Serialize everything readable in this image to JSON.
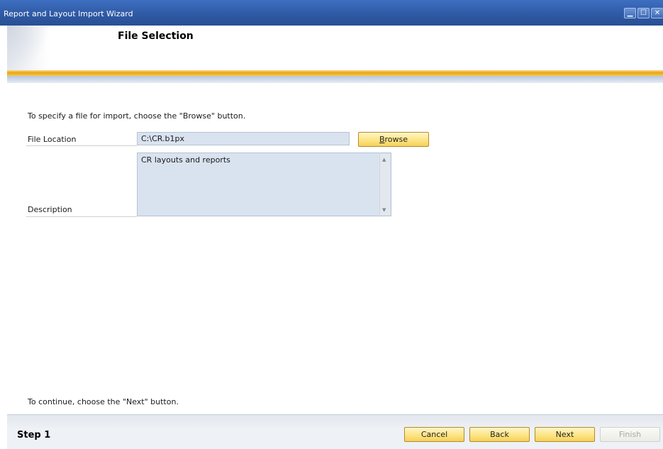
{
  "window": {
    "title": "Report and Layout Import Wizard",
    "controls": [
      "minimize-icon",
      "maximize-icon",
      "close-icon"
    ]
  },
  "header": {
    "page_title": "File Selection"
  },
  "main": {
    "instruction": "To specify a file for import, choose the \"Browse\" button.",
    "file_location": {
      "label": "File Location",
      "value": "C:\\CR.b1px",
      "browse_label": "Browse",
      "browse_mnemonic": "B",
      "browse_rest": "rowse"
    },
    "description": {
      "label": "Description",
      "value": "CR layouts and reports"
    },
    "continue_hint": "To continue, choose the \"Next\" button."
  },
  "footer": {
    "step": "Step 1",
    "buttons": {
      "cancel": "Cancel",
      "back": "Back",
      "next": "Next",
      "finish": "Finish"
    }
  },
  "colors": {
    "titlebar": "#2f5aa5",
    "accent_orange": "#e9a510",
    "field_bg": "#d9e3f0",
    "button_yellow": "#fde68a"
  }
}
